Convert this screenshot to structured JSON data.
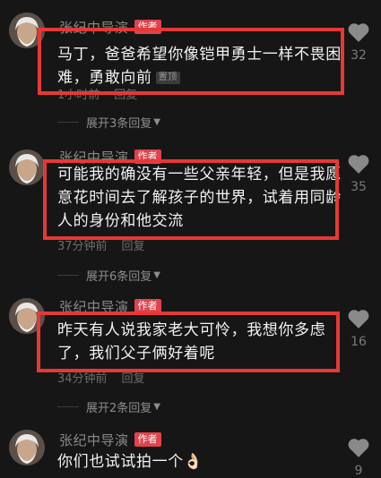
{
  "comments": [
    {
      "author": "张纪中导演",
      "badge": "作者",
      "text": "马丁，爸爸希望你像铠甲勇士一样不畏困难，勇敢向前",
      "pin": "置顶",
      "time": "1小时前",
      "reply": "回复",
      "expand": "展开3条回复",
      "likes": "32"
    },
    {
      "author": "张纪中导演",
      "badge": "作者",
      "text": "可能我的确没有一些父亲年轻，但是我愿意花时间去了解孩子的世界，试着用同龄人的身份和他交流",
      "time": "37分钟前",
      "reply": "回复",
      "expand": "展开6条回复",
      "likes": "35"
    },
    {
      "author": "张纪中导演",
      "badge": "作者",
      "text": "昨天有人说我家老大可怜，我想你多虑了，我们父子俩好着呢",
      "time": "34分钟前",
      "reply": "回复",
      "expand": "展开2条回复",
      "likes": "16"
    },
    {
      "author": "张纪中导演",
      "badge": "作者",
      "text": "你们也试试拍一个👌🏻",
      "likes": "9"
    }
  ],
  "colors": {
    "highlight": "#e53935",
    "badge": "#e0434e",
    "background": "#161616"
  },
  "icons": {
    "like": "heart-icon",
    "expand": "chevron-down-icon"
  }
}
